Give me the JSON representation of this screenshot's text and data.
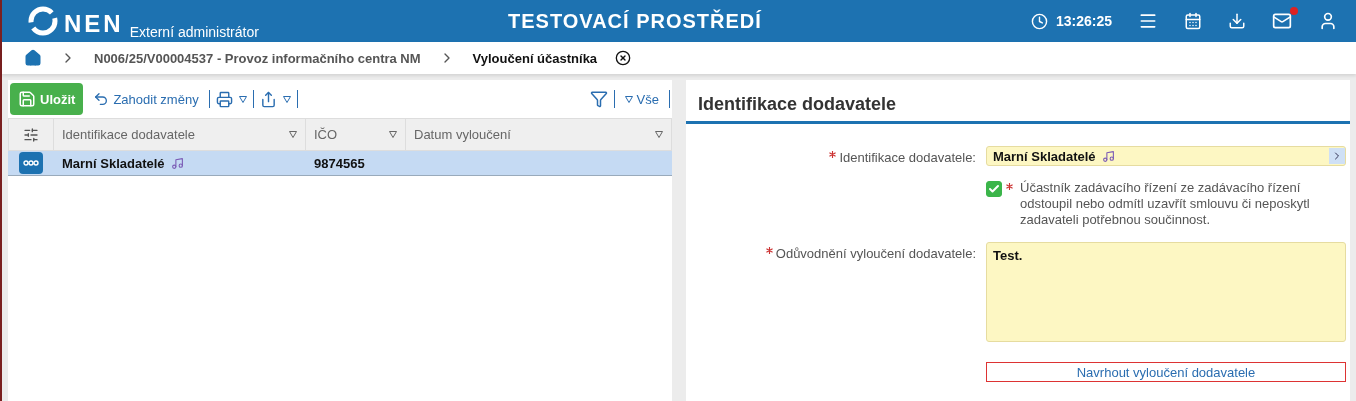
{
  "header": {
    "logo": "NEN",
    "subtitle": "Externí administrátor",
    "title": "TESTOVACÍ PROSTŘEDÍ",
    "time": "13:26:25",
    "mail_unread": true
  },
  "breadcrumb": [
    {
      "label": "N006/25/V00004537 - Provoz informačního centra NM",
      "current": false
    },
    {
      "label": "Vyloučení účastníka",
      "current": true
    }
  ],
  "toolbar": {
    "save": "Uložit",
    "discard": "Zahodit změny",
    "filter": "Vše"
  },
  "table": {
    "columns": [
      "Identifikace dodavatele",
      "IČO",
      "Datum vyloučení"
    ],
    "rows": [
      {
        "cells": [
          "Marní Skladatelé",
          "9874565",
          ""
        ],
        "selected": true
      }
    ]
  },
  "form": {
    "title": "Identifikace dodavatele",
    "fields": [
      {
        "kind": "lookup",
        "label": "Identifikace dodavatele:",
        "required": true,
        "value": "Marní Skladatelé"
      },
      {
        "kind": "checkbox",
        "label": "Účastník zadávacího řízení ze zadávacího řízení odstoupil nebo odmítl uzavřít smlouvu či neposkytl zadavateli potřebnou součinnost.",
        "required": true,
        "checked": true
      },
      {
        "kind": "textarea",
        "label": "Odůvodnění vyloučení dodavatele:",
        "required": true,
        "value": "Test."
      }
    ],
    "action": "Navrhout vyloučení dodavatele"
  }
}
